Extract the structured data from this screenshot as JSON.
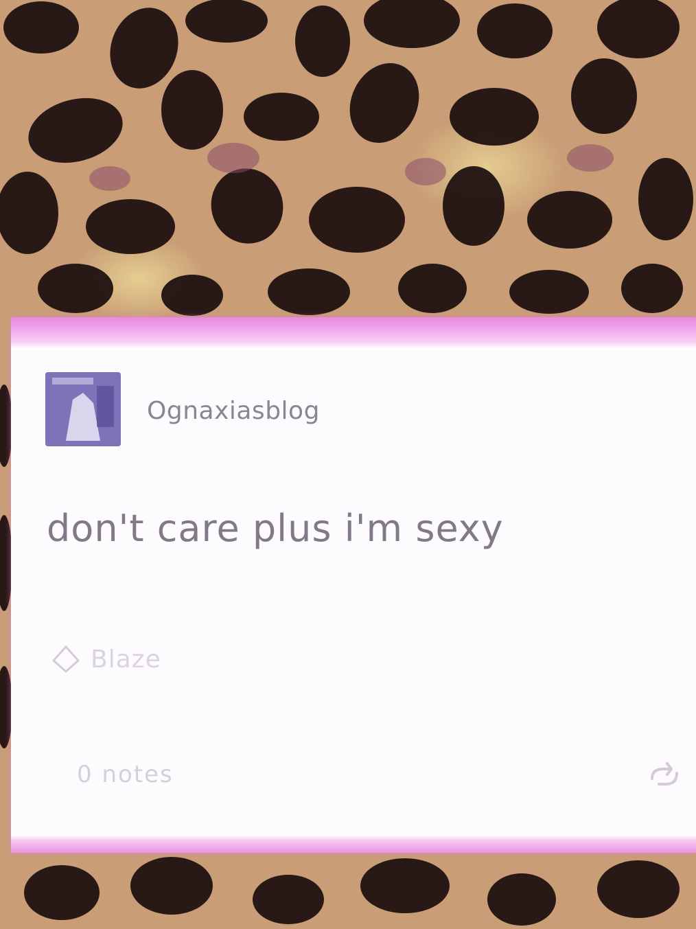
{
  "post": {
    "blog_name": "Ognaxiasblog",
    "text": "don't care plus i'm sexy",
    "tag": "Blaze",
    "notes": "0 notes"
  },
  "icons": {
    "avatar": "blog-avatar",
    "tag": "tag-icon",
    "reblog": "reblog-icon"
  },
  "colors": {
    "frame_pink": "#ee9be6",
    "card_background": "#fefbff",
    "text_gray": "#7f7a86"
  }
}
